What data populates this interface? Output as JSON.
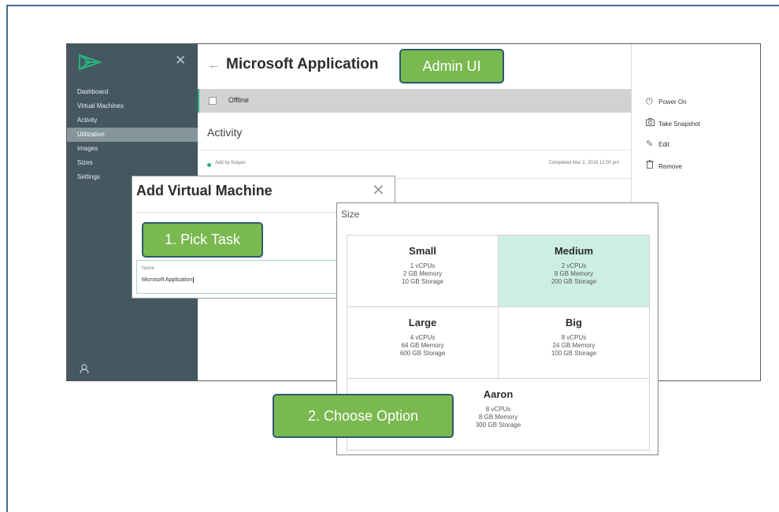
{
  "app": {
    "sidebar": {
      "items": [
        {
          "label": "Dashboard",
          "active": false
        },
        {
          "label": "Virtual Machines",
          "active": false
        },
        {
          "label": "Activity",
          "active": false
        },
        {
          "label": "Utilization",
          "active": true
        },
        {
          "label": "Images",
          "active": false
        },
        {
          "label": "Sizes",
          "active": false
        },
        {
          "label": "Settings",
          "active": false
        }
      ]
    },
    "header": {
      "back_icon": "back-arrow-icon",
      "title": "Microsoft Application"
    },
    "status": {
      "label": "Offline"
    },
    "activity": {
      "title": "Activity",
      "rows": [
        {
          "text": "Add by Kalyan",
          "completed": "Completed   Mar 2, 2016 12:00 pm"
        }
      ]
    },
    "actions": [
      {
        "icon": "power-icon",
        "label": "Power On"
      },
      {
        "icon": "camera-icon",
        "label": "Take Snapshot"
      },
      {
        "icon": "pencil-icon",
        "label": "Edit"
      },
      {
        "icon": "trash-icon",
        "label": "Remove"
      }
    ]
  },
  "dialog": {
    "title": "Add Virtual Machine",
    "name_label": "Name",
    "name_value": "Microsoft Application"
  },
  "size_panel": {
    "title": "Size",
    "options": [
      {
        "name": "Small",
        "vcpus": "1 vCPUs",
        "memory": "2 GB Memory",
        "storage": "10 GB Storage",
        "selected": false
      },
      {
        "name": "Medium",
        "vcpus": "2 vCPUs",
        "memory": "8 GB Memory",
        "storage": "200 GB Storage",
        "selected": true
      },
      {
        "name": "Large",
        "vcpus": "4 vCPUs",
        "memory": "64 GB Memory",
        "storage": "600 GB Storage",
        "selected": false
      },
      {
        "name": "Big",
        "vcpus": "8 vCPUs",
        "memory": "24 GB Memory",
        "storage": "100 GB Storage",
        "selected": false
      },
      {
        "name": "Aaron",
        "vcpus": "8 vCPUs",
        "memory": "8 GB Memory",
        "storage": "300 GB Storage",
        "selected": false
      }
    ]
  },
  "callouts": {
    "admin_ui": "Admin UI",
    "pick_task": "1. Pick Task",
    "choose_option": "2. Choose Option"
  },
  "colors": {
    "sidebar_bg": "#455861",
    "accent_green": "#2ab27b",
    "selected_card": "#cdeee4",
    "callout_green": "#79b94f",
    "callout_border": "#2d5a6f"
  }
}
